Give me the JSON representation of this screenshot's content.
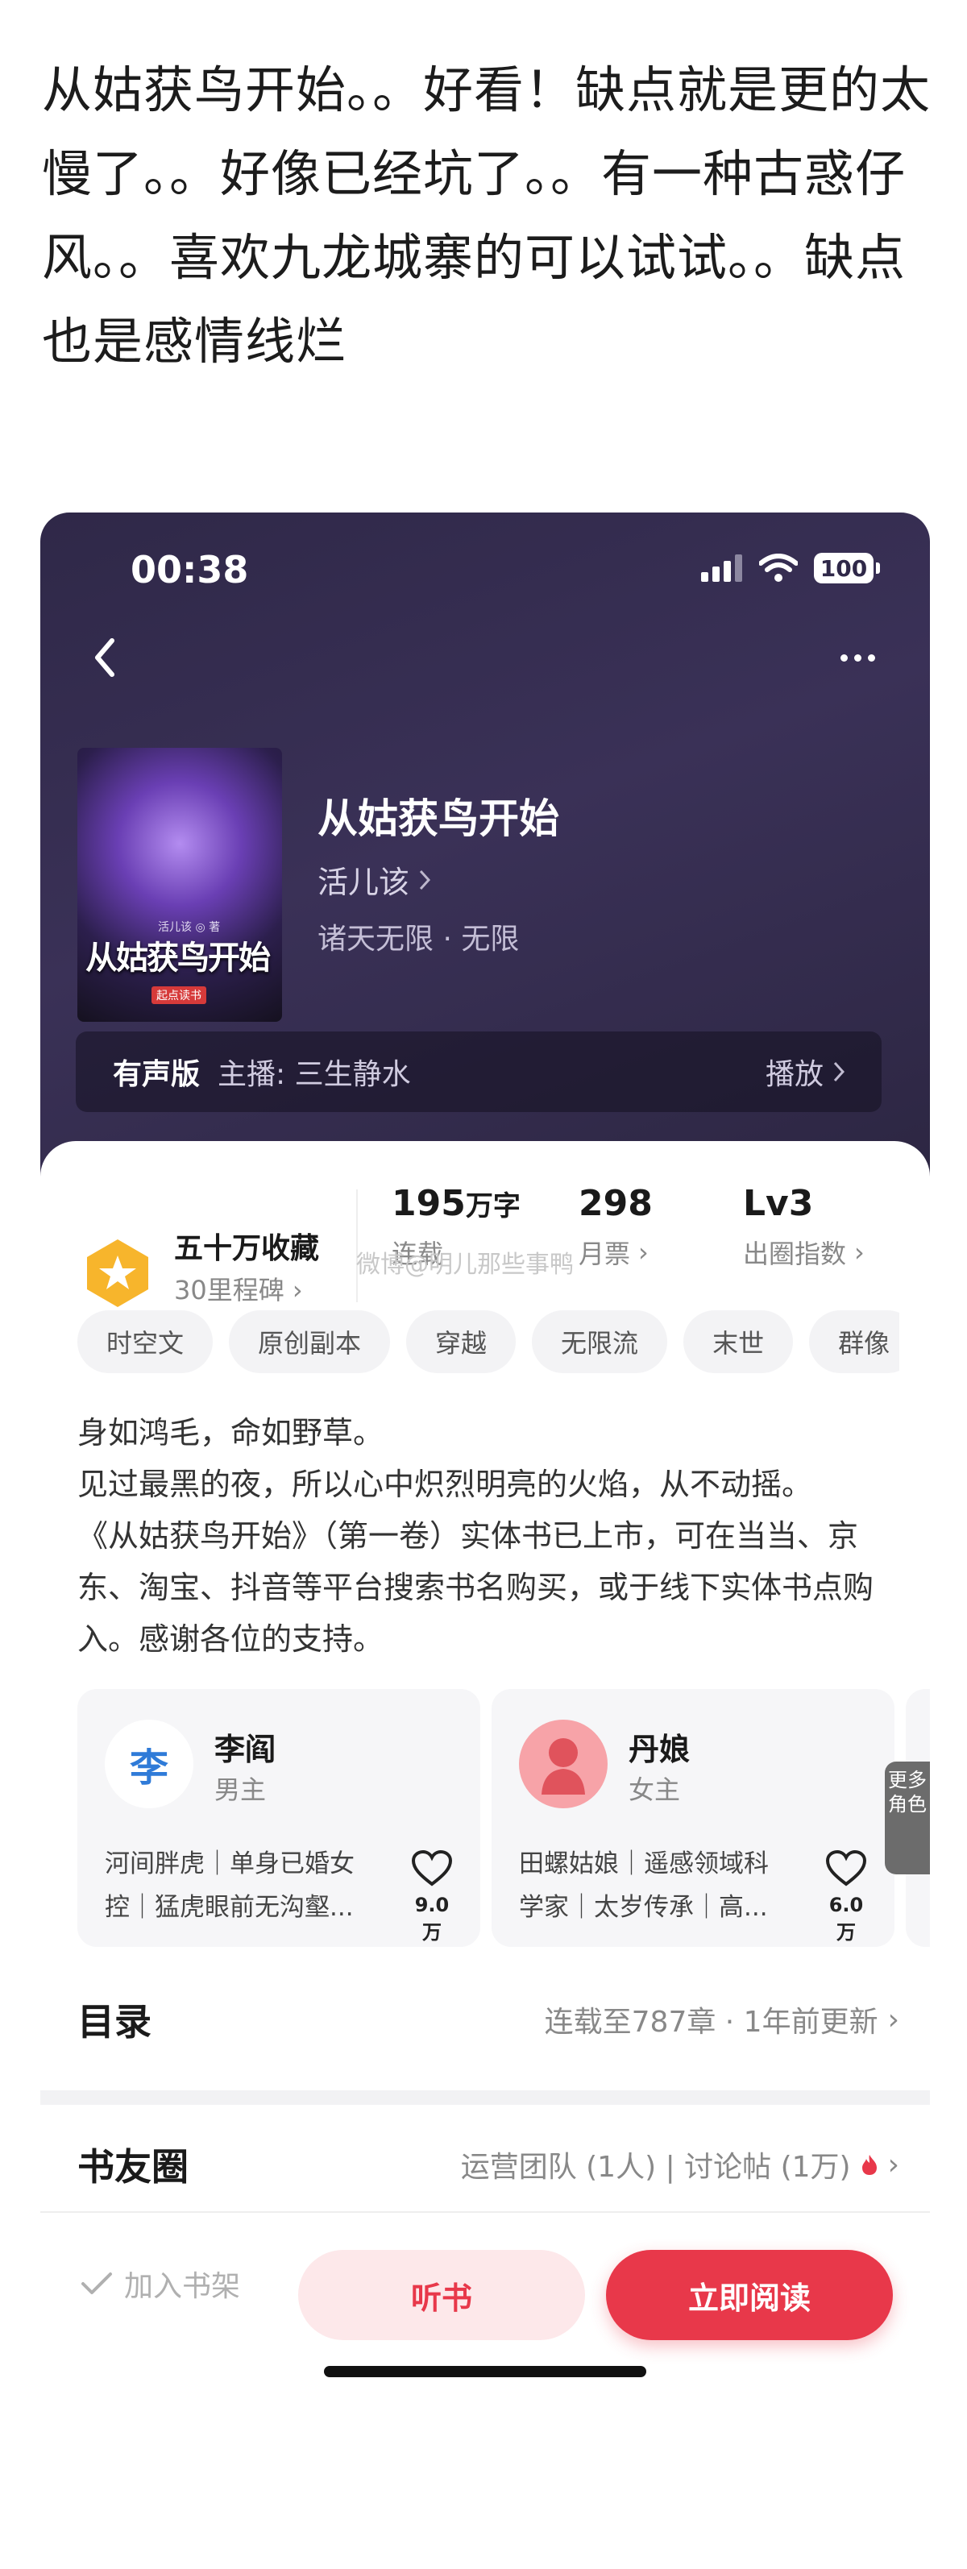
{
  "post": {
    "text": "从姑获鸟开始。。好看！缺点就是更的太慢了。。好像已经坑了。。有一种古惑仔风。。喜欢九龙城寨的可以试试。。缺点也是感情线烂"
  },
  "status_bar": {
    "time": "00:38",
    "battery": "100"
  },
  "book": {
    "title": "从姑获鸟开始",
    "author": "活儿该",
    "genre": "诸天无限 · 无限",
    "cover_title": "从姑获鸟开始",
    "cover_author": "活儿该 ◎ 著",
    "cover_publisher": "起点读书"
  },
  "audio": {
    "tag": "有声版",
    "host": "主播:  三生静水",
    "play": "播放"
  },
  "favorites": {
    "title": "五十万收藏",
    "sub": "30里程碑"
  },
  "stats": [
    {
      "value": "195",
      "unit": "万字",
      "label": "连载"
    },
    {
      "value": "298",
      "unit": "",
      "label": "月票"
    },
    {
      "value": "Lv3",
      "unit": "",
      "label": "出圈指数"
    }
  ],
  "watermark": "微博@明儿那些事鸭",
  "tags": [
    "时空文",
    "原创副本",
    "穿越",
    "无限流",
    "末世",
    "群像"
  ],
  "description": [
    "身如鸿毛，命如野草。",
    "见过最黑的夜，所以心中炽烈明亮的火焰，从不动摇。",
    "《从姑获鸟开始》（第一卷）实体书已上市，可在当当、京东、淘宝、抖音等平台搜索书名购买，或于线下实体书点购入。感谢各位的支持。"
  ],
  "roles": [
    {
      "avatar_char": "李",
      "name": "李阎",
      "sex": "男主",
      "desc": "河间胖虎｜单身已婚女控｜猛虎眼前无沟壑...",
      "likes": "9.0万"
    },
    {
      "avatar_char": "",
      "name": "丹娘",
      "sex": "女主",
      "desc": "田螺姑娘｜遥感领域科学家｜太岁传承｜高...",
      "likes": "6.0万"
    }
  ],
  "more_roles": "更多角色",
  "toc": {
    "title": "目录",
    "info": "连载至787章 · 1年前更新"
  },
  "club": {
    "title": "书友圈",
    "info": "运营团队 (1人) | 讨论帖 (1万)"
  },
  "actions": {
    "shelf": "加入书架",
    "listen": "听书",
    "read": "立即阅读"
  },
  "colors": {
    "accent": "#e8384a",
    "hero_bg": "#2f2848",
    "medal": "#f7b52c"
  }
}
